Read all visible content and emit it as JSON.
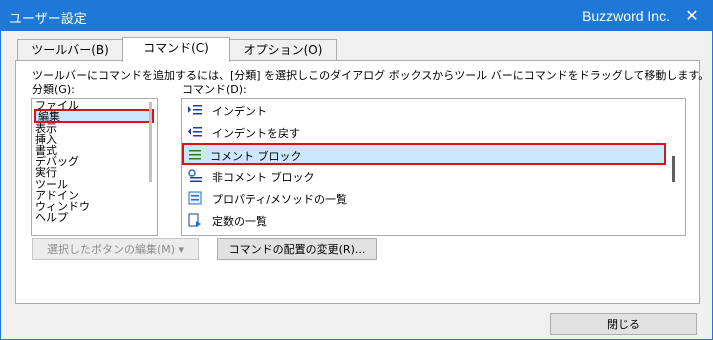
{
  "window": {
    "title": "ユーザー設定",
    "brand": "Buzzword Inc.",
    "close_glyph": "✕"
  },
  "tabs": [
    {
      "label": "ツールバー(B)",
      "selected": false
    },
    {
      "label": "コマンド(C)",
      "selected": true
    },
    {
      "label": "オプション(O)",
      "selected": false
    }
  ],
  "instruction": "ツールバーにコマンドを追加するには、[分類] を選択しこのダイアログ ボックスからツール バーにコマンドをドラッグして移動します。",
  "categories": {
    "label": "分類(G):",
    "items": [
      "ファイル",
      "編集",
      "表示",
      "挿入",
      "書式",
      "デバッグ",
      "実行",
      "ツール",
      "アドイン",
      "ウィンドウ",
      "ヘルプ"
    ],
    "selected": "編集"
  },
  "commands": {
    "label": "コマンド(D):",
    "items": [
      {
        "label": "インデント",
        "icon": "indent-icon"
      },
      {
        "label": "インデントを戻す",
        "icon": "outdent-icon"
      },
      {
        "label": "コメント ブロック",
        "icon": "comment-block-icon"
      },
      {
        "label": "非コメント ブロック",
        "icon": "uncomment-block-icon"
      },
      {
        "label": "プロパティ/メソッドの一覧",
        "icon": "property-list-icon"
      },
      {
        "label": "定数の一覧",
        "icon": "constant-list-icon"
      }
    ],
    "selected": "コメント ブロック"
  },
  "buttons": {
    "modify_selection": "選択したボタンの編集(M) ▾",
    "rearrange_commands": "コマンドの配置の変更(R)...",
    "close": "閉じる"
  },
  "colors": {
    "titlebar": "#1e78d7",
    "selection": "#cce8ff",
    "highlight_border": "#d8131c"
  }
}
